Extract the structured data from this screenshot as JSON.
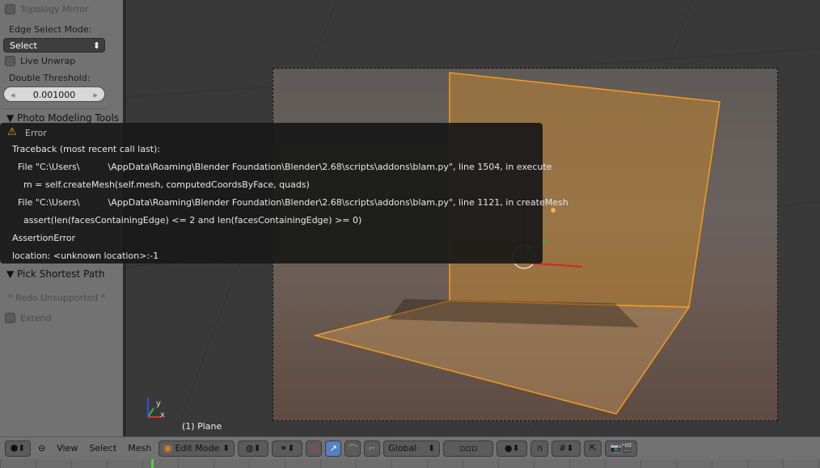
{
  "left_panel": {
    "topology_mirror": "Topology Mirror",
    "edge_select_mode_label": "Edge Select Mode:",
    "edge_select_mode_value": "Select",
    "live_unwrap": "Live Unwrap",
    "double_threshold_label": "Double Threshold:",
    "double_threshold_value": "0.001000",
    "photo_modeling_tools": "Photo Modeling Tools",
    "pick_shortest_path": "Pick Shortest Path",
    "redo_unsupported": "* Redo Unsupported *",
    "extend": "Extend"
  },
  "error": {
    "title": "Error",
    "lines": [
      "Traceback (most recent call last):",
      "  File \"C:\\Users\\          \\AppData\\Roaming\\Blender Foundation\\Blender\\2.68\\scripts\\addons\\blam.py\", line 1504, in execute",
      "    m = self.createMesh(self.mesh, computedCoordsByFace, quads)",
      "  File \"C:\\Users\\          \\AppData\\Roaming\\Blender Foundation\\Blender\\2.68\\scripts\\addons\\blam.py\", line 1121, in createMesh",
      "    assert(len(facesContainingEdge) <= 2 and len(facesContainingEdge) >= 0)",
      "AssertionError",
      "location: <unknown location>:-1"
    ]
  },
  "viewport": {
    "object_label": "(1) Plane",
    "axis_y": "y",
    "axis_x": "x"
  },
  "header": {
    "view": "View",
    "select": "Select",
    "mesh": "Mesh",
    "mode": "Edit Mode",
    "orientation": "Global"
  },
  "colors": {
    "selection": "#f39c1e",
    "warning": "#f0a020",
    "frame_marker": "#4fd13a"
  }
}
